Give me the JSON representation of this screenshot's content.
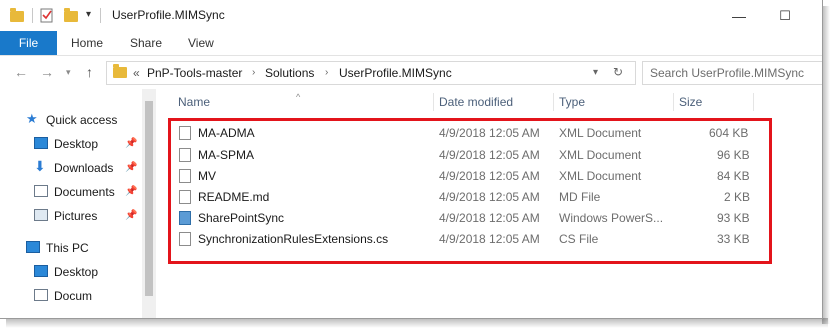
{
  "window": {
    "title": "UserProfile.MIMSync",
    "minimize": "—",
    "maximize": "☐"
  },
  "ribbon": {
    "tabs": [
      "File",
      "Home",
      "Share",
      "View"
    ]
  },
  "address": {
    "overflow": "«",
    "crumbs": [
      "PnP-Tools-master",
      "Solutions",
      "UserProfile.MIMSync"
    ],
    "search_placeholder": "Search UserProfile.MIMSync"
  },
  "navpane": {
    "items": [
      {
        "label": "Quick access",
        "icon": "star-icon",
        "pinned": false
      },
      {
        "label": "Desktop",
        "icon": "desktop-icon",
        "pinned": true
      },
      {
        "label": "Downloads",
        "icon": "download-icon",
        "pinned": true
      },
      {
        "label": "Documents",
        "icon": "documents-icon",
        "pinned": true
      },
      {
        "label": "Pictures",
        "icon": "pictures-icon",
        "pinned": true
      },
      {
        "label": "This PC",
        "icon": "computer-icon",
        "pinned": false
      },
      {
        "label": "Desktop",
        "icon": "desktop-icon",
        "pinned": false
      },
      {
        "label": "Docum",
        "icon": "documents-icon",
        "pinned": false
      }
    ]
  },
  "columns": {
    "name": "Name",
    "date": "Date modified",
    "type": "Type",
    "size": "Size"
  },
  "files": [
    {
      "name": "MA-ADMA",
      "date": "4/9/2018 12:05 AM",
      "type": "XML Document",
      "size": "604 KB",
      "icon": "xml-file-icon"
    },
    {
      "name": "MA-SPMA",
      "date": "4/9/2018 12:05 AM",
      "type": "XML Document",
      "size": "96 KB",
      "icon": "xml-file-icon"
    },
    {
      "name": "MV",
      "date": "4/9/2018 12:05 AM",
      "type": "XML Document",
      "size": "84 KB",
      "icon": "xml-file-icon"
    },
    {
      "name": "README.md",
      "date": "4/9/2018 12:05 AM",
      "type": "MD File",
      "size": "2 KB",
      "icon": "text-file-icon"
    },
    {
      "name": "SharePointSync",
      "date": "4/9/2018 12:05 AM",
      "type": "Windows PowerS...",
      "size": "93 KB",
      "icon": "powershell-file-icon"
    },
    {
      "name": "SynchronizationRulesExtensions.cs",
      "date": "4/9/2018 12:05 AM",
      "type": "CS File",
      "size": "33 KB",
      "icon": "text-file-icon"
    }
  ],
  "colors": {
    "file_tab": "#1979ca",
    "highlight_box": "#e3141b",
    "folder": "#e8b93a"
  }
}
